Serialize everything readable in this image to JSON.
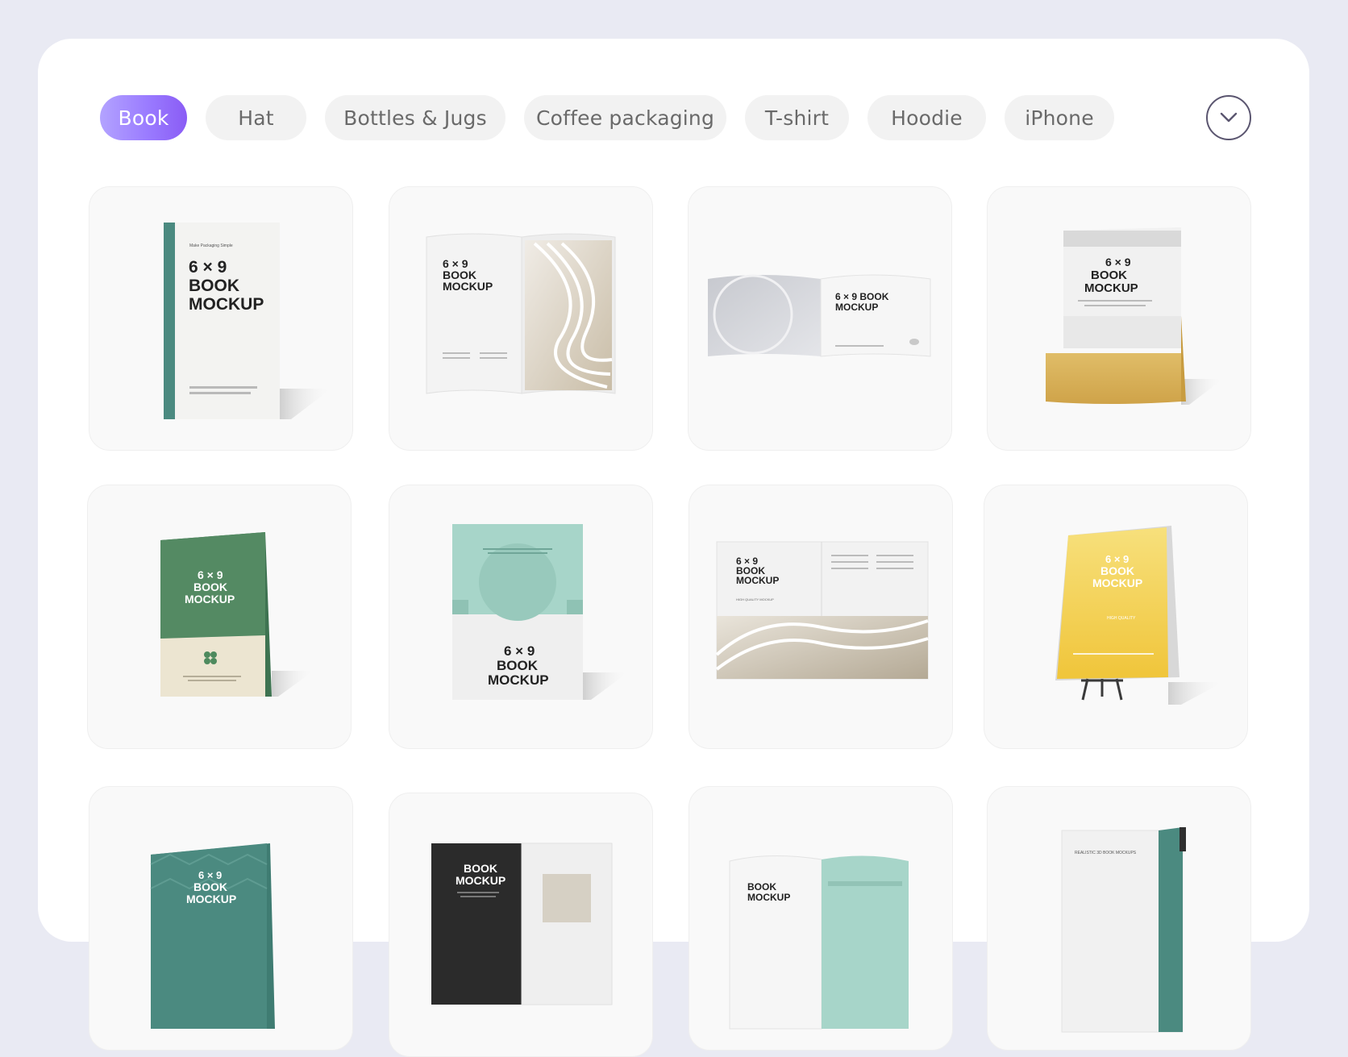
{
  "tabs": [
    {
      "label": "Book",
      "active": true
    },
    {
      "label": "Hat",
      "active": false
    },
    {
      "label": "Bottles & Jugs",
      "active": false
    },
    {
      "label": "Coffee packaging",
      "active": false
    },
    {
      "label": "T-shirt",
      "active": false
    },
    {
      "label": "Hoodie",
      "active": false
    },
    {
      "label": "iPhone",
      "active": false
    }
  ],
  "more_button_icon": "chevron-down-icon",
  "colors": {
    "accent_start": "#b3a3ff",
    "accent_end": "#8a5cf5",
    "page_bg": "#e9eaf3",
    "teal": "#4b8a80",
    "green": "#548a63",
    "mint": "#a7d5c9",
    "yellow": "#f3cf4f",
    "gold": "#d9b35c"
  },
  "mockups": {
    "size_line": "6 × 9",
    "book_line": "BOOK",
    "mockup_line": "MOCKUP",
    "size_book_line": "6 × 9 BOOK",
    "brand_tag": "Make Packaging Simple",
    "quality_tag": "HIGH QUALITY MOCKUP",
    "quality_tag_short": "HIGH QUALITY",
    "realistic_tag": "REALISTIC 3D BOOK MOCKUPS"
  }
}
